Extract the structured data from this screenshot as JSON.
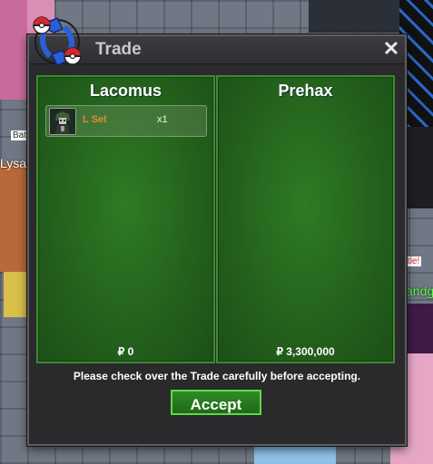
{
  "background": {
    "labels": {
      "bat": "Bat",
      "lysa": "Lysa",
      "tle": "tle!",
      "andg": "andg"
    }
  },
  "window": {
    "title": "Trade",
    "close_icon": "close-icon",
    "logo_icon": "trade-arrows-icon"
  },
  "left_panel": {
    "player": "Lacomus",
    "items": [
      {
        "name": "L Set",
        "qty": "x1",
        "icon": "character-portrait-icon"
      }
    ],
    "money": "₽ 0"
  },
  "right_panel": {
    "player": "Prehax",
    "items": [],
    "money": "₽ 3,300,000"
  },
  "notice": "Please check over the Trade carefully before accepting.",
  "accept_label": "Accept",
  "colors": {
    "panel_green": "#24621c",
    "panel_border": "#3e8a32",
    "accept_green": "#2f8b26",
    "item_name": "#e08a2f"
  }
}
